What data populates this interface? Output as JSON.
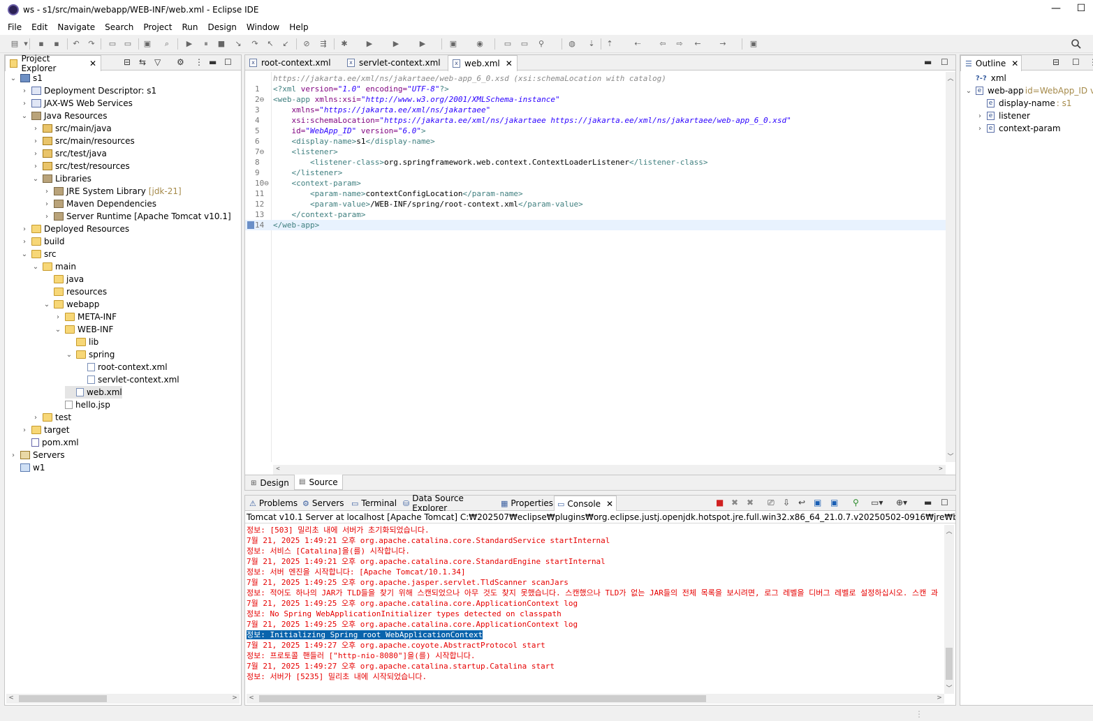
{
  "window": {
    "title": "ws - s1/src/main/webapp/WEB-INF/web.xml - Eclipse IDE",
    "minimize": "—",
    "maximize": "☐"
  },
  "menu": [
    "File",
    "Edit",
    "Navigate",
    "Search",
    "Project",
    "Run",
    "Design",
    "Window",
    "Help"
  ],
  "project_explorer": {
    "tab_label": "Project Explorer",
    "items": [
      {
        "label": "s1",
        "extra": ""
      },
      {
        "label": "Deployment Descriptor: s1",
        "extra": ""
      },
      {
        "label": "JAX-WS Web Services",
        "extra": ""
      },
      {
        "label": "Java Resources",
        "extra": ""
      },
      {
        "label": "src/main/java",
        "extra": ""
      },
      {
        "label": "src/main/resources",
        "extra": ""
      },
      {
        "label": "src/test/java",
        "extra": ""
      },
      {
        "label": "src/test/resources",
        "extra": ""
      },
      {
        "label": "Libraries",
        "extra": ""
      },
      {
        "label": "JRE System Library",
        "extra": "[jdk-21]"
      },
      {
        "label": "Maven Dependencies",
        "extra": ""
      },
      {
        "label": "Server Runtime [Apache Tomcat v10.1]",
        "extra": ""
      },
      {
        "label": "Deployed Resources",
        "extra": ""
      },
      {
        "label": "build",
        "extra": ""
      },
      {
        "label": "src",
        "extra": ""
      },
      {
        "label": "main",
        "extra": ""
      },
      {
        "label": "java",
        "extra": ""
      },
      {
        "label": "resources",
        "extra": ""
      },
      {
        "label": "webapp",
        "extra": ""
      },
      {
        "label": "META-INF",
        "extra": ""
      },
      {
        "label": "WEB-INF",
        "extra": ""
      },
      {
        "label": "lib",
        "extra": ""
      },
      {
        "label": "spring",
        "extra": ""
      },
      {
        "label": "root-context.xml",
        "extra": ""
      },
      {
        "label": "servlet-context.xml",
        "extra": ""
      },
      {
        "label": "web.xml",
        "extra": ""
      },
      {
        "label": "hello.jsp",
        "extra": ""
      },
      {
        "label": "test",
        "extra": ""
      },
      {
        "label": "target",
        "extra": ""
      },
      {
        "label": "pom.xml",
        "extra": ""
      },
      {
        "label": "Servers",
        "extra": ""
      },
      {
        "label": "w1",
        "extra": ""
      }
    ]
  },
  "editor": {
    "tabs": [
      "root-context.xml",
      "servlet-context.xml",
      "web.xml"
    ],
    "hint": "https://jakarta.ee/xml/ns/jakartaee/web-app_6_0.xsd (xsi:schemaLocation with catalog)",
    "line_numbers": [
      "1",
      "2⊖",
      "3",
      "4",
      "5",
      "6",
      "7⊖",
      "8",
      "9",
      "10⊖",
      "11",
      "12",
      "13",
      "14"
    ],
    "lines": [
      [
        [
          "pi",
          "<?xml "
        ],
        [
          "attr",
          "version="
        ],
        [
          "str",
          "\"1.0\""
        ],
        [
          "attr",
          " encoding="
        ],
        [
          "str",
          "\"UTF-8\""
        ],
        [
          "pi",
          "?>"
        ]
      ],
      [
        [
          "tag",
          "<web-app "
        ],
        [
          "attr",
          "xmlns:xsi="
        ],
        [
          "str",
          "\"http://www.w3.org/2001/XMLSchema-instance\""
        ]
      ],
      [
        [
          "txt",
          "    "
        ],
        [
          "attr",
          "xmlns="
        ],
        [
          "str",
          "\"https://jakarta.ee/xml/ns/jakartaee\""
        ]
      ],
      [
        [
          "txt",
          "    "
        ],
        [
          "attr",
          "xsi:schemaLocation="
        ],
        [
          "str",
          "\"https://jakarta.ee/xml/ns/jakartaee https://jakarta.ee/xml/ns/jakartaee/web-app_6_0.xsd\""
        ]
      ],
      [
        [
          "txt",
          "    "
        ],
        [
          "attr",
          "id="
        ],
        [
          "str",
          "\"WebApp_ID\""
        ],
        [
          "attr",
          " version="
        ],
        [
          "str",
          "\"6.0\""
        ],
        [
          "tag",
          ">"
        ]
      ],
      [
        [
          "txt",
          "    "
        ],
        [
          "tag",
          "<display-name>"
        ],
        [
          "txt",
          "s1"
        ],
        [
          "tag",
          "</display-name>"
        ]
      ],
      [
        [
          "txt",
          "    "
        ],
        [
          "tag",
          "<listener>"
        ]
      ],
      [
        [
          "txt",
          "        "
        ],
        [
          "tag",
          "<listener-class>"
        ],
        [
          "txt",
          "org.springframework.web.context.ContextLoaderListener"
        ],
        [
          "tag",
          "</listener-class>"
        ]
      ],
      [
        [
          "txt",
          "    "
        ],
        [
          "tag",
          "</listener>"
        ]
      ],
      [
        [
          "txt",
          "    "
        ],
        [
          "tag",
          "<context-param>"
        ]
      ],
      [
        [
          "txt",
          "        "
        ],
        [
          "tag",
          "<param-name>"
        ],
        [
          "txt",
          "contextConfigLocation"
        ],
        [
          "tag",
          "</param-name>"
        ]
      ],
      [
        [
          "txt",
          "        "
        ],
        [
          "tag",
          "<param-value>"
        ],
        [
          "txt",
          "/WEB-INF/spring/root-context.xml"
        ],
        [
          "tag",
          "</param-value>"
        ]
      ],
      [
        [
          "txt",
          "    "
        ],
        [
          "tag",
          "</context-param>"
        ]
      ],
      [
        [
          "tag",
          "</web-app>"
        ]
      ]
    ],
    "bottom_tabs": [
      "Design",
      "Source"
    ]
  },
  "outline": {
    "tab_label": "Outline",
    "items": [
      {
        "label": "xml",
        "extra": ""
      },
      {
        "label": "web-app",
        "extra": "id=WebApp_ID ve"
      },
      {
        "label": "display-name",
        "extra": " : s1"
      },
      {
        "label": "listener",
        "extra": ""
      },
      {
        "label": "context-param",
        "extra": ""
      }
    ]
  },
  "bottom_panel": {
    "tabs": [
      "Problems",
      "Servers",
      "Terminal",
      "Data Source Explorer",
      "Properties",
      "Console"
    ],
    "console_header": "Tomcat v10.1 Server at localhost [Apache Tomcat] C:₩202507₩eclipse₩plugins₩org.eclipse.justj.openjdk.hotspot.jre.full.win32.x86_64_21.0.7.v20250502-0916₩jre₩bin₩javaw.exe  (2025.",
    "lines": [
      "정보: [503] 밀리초 내에 서버가 초기화되었습니다.",
      "7월 21, 2025 1:49:21 오후 org.apache.catalina.core.StandardService startInternal",
      "정보: 서비스 [Catalina]을(를) 시작합니다.",
      "7월 21, 2025 1:49:21 오후 org.apache.catalina.core.StandardEngine startInternal",
      "정보: 서버 엔진을 시작합니다: [Apache Tomcat/10.1.34]",
      "7월 21, 2025 1:49:25 오후 org.apache.jasper.servlet.TldScanner scanJars",
      "정보: 적어도 하나의 JAR가 TLD들을 찾기 위해 스캔되었으나 아무 것도 찾지 못했습니다. 스캔했으나 TLD가 없는 JAR들의 전체 목록을 보시려면, 로그 레벨을 디버그 레벨로 설정하십시오. 스캔 과",
      "7월 21, 2025 1:49:25 오후 org.apache.catalina.core.ApplicationContext log",
      "정보: No Spring WebApplicationInitializer types detected on classpath",
      "7월 21, 2025 1:49:25 오후 org.apache.catalina.core.ApplicationContext log",
      "정보: Initializing Spring root WebApplicationContext",
      "7월 21, 2025 1:49:27 오후 org.apache.coyote.AbstractProtocol start",
      "정보: 프로토콜 핸들러 [\"http-nio-8080\"]을(를) 시작합니다.",
      "7월 21, 2025 1:49:27 오후 org.apache.catalina.startup.Catalina start",
      "정보: 서버가 [5235] 밀리초 내에 시작되었습니다."
    ],
    "highlighted_line": 10
  }
}
